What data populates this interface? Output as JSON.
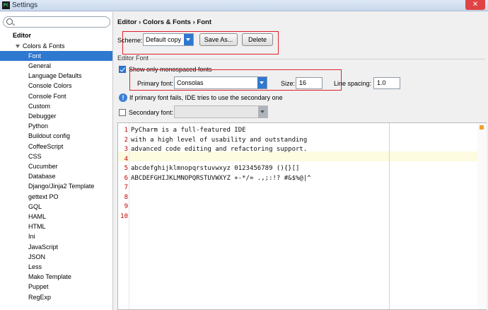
{
  "window": {
    "title": "Settings",
    "icon_text": "PC",
    "close_label": "✕"
  },
  "sidebar": {
    "search_placeholder": "",
    "items": [
      {
        "label": "Editor",
        "level": 0,
        "bold": true
      },
      {
        "label": "Colors & Fonts",
        "level": 1,
        "expanded": true
      },
      {
        "label": "Font",
        "level": 2,
        "selected": true
      },
      {
        "label": "General",
        "level": 2
      },
      {
        "label": "Language Defaults",
        "level": 2
      },
      {
        "label": "Console Colors",
        "level": 2
      },
      {
        "label": "Console Font",
        "level": 2
      },
      {
        "label": "Custom",
        "level": 2
      },
      {
        "label": "Debugger",
        "level": 2
      },
      {
        "label": "Python",
        "level": 2
      },
      {
        "label": "Buildout config",
        "level": 2
      },
      {
        "label": "CoffeeScript",
        "level": 2
      },
      {
        "label": "CSS",
        "level": 2
      },
      {
        "label": "Cucumber",
        "level": 2
      },
      {
        "label": "Database",
        "level": 2
      },
      {
        "label": "Django/Jinja2 Template",
        "level": 2
      },
      {
        "label": "gettext PO",
        "level": 2
      },
      {
        "label": "GQL",
        "level": 2
      },
      {
        "label": "HAML",
        "level": 2
      },
      {
        "label": "HTML",
        "level": 2
      },
      {
        "label": "Ini",
        "level": 2
      },
      {
        "label": "JavaScript",
        "level": 2
      },
      {
        "label": "JSON",
        "level": 2
      },
      {
        "label": "Less",
        "level": 2
      },
      {
        "label": "Mako Template",
        "level": 2
      },
      {
        "label": "Puppet",
        "level": 2
      },
      {
        "label": "RegExp",
        "level": 2
      }
    ]
  },
  "main": {
    "breadcrumb": "Editor › Colors & Fonts › Font",
    "scheme_label": "Scheme:",
    "scheme_value": "Default copy",
    "save_as_label": "Save As...",
    "delete_label": "Delete",
    "section_label": "Editor Font",
    "monospaced_label": "Show only monospaced fonts",
    "monospaced_checked": true,
    "primary_font_label": "Primary font:",
    "primary_font_value": "Consolas",
    "size_label": "Size:",
    "size_value": "16",
    "line_spacing_label": "Line spacing:",
    "line_spacing_value": "1.0",
    "info_text": "If primary font fails, IDE tries to use the secondary one",
    "secondary_font_label": "Secondary font:",
    "secondary_font_checked": false,
    "secondary_font_value": ""
  },
  "preview": {
    "line_numbers": [
      "1",
      "2",
      "3",
      "4",
      "5",
      "6",
      "7",
      "8",
      "9",
      "10"
    ],
    "lines": [
      "PyCharm is a full-featured IDE",
      "with a high level of usability and outstanding",
      "advanced code editing and refactoring support.",
      "",
      "abcdefghijklmnopqrstuvwxyz 0123456789 (){}[]",
      "ABCDEFGHIJKLMNOPQRSTUVWXYZ +-*/= .,;:!? #&$%@|^",
      "",
      "",
      "",
      ""
    ]
  },
  "colors": {
    "accent": "#2f78d0",
    "highlight_box": "#e0202a",
    "line_number": "#c00000",
    "caret_row": "#fdfbe0"
  }
}
